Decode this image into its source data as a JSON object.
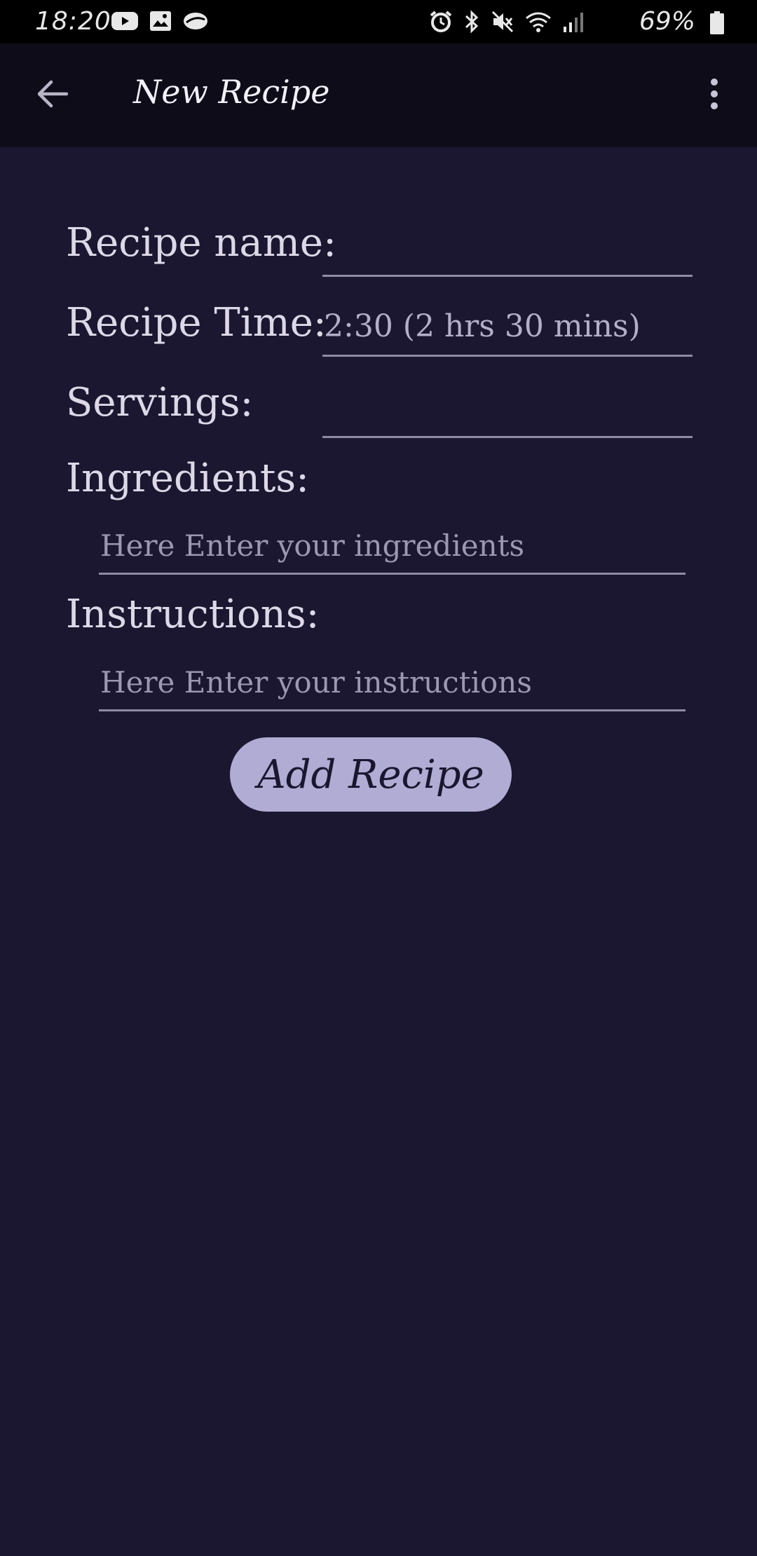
{
  "status_bar": {
    "time": "18:20",
    "battery_percent": "69%",
    "left_icons": [
      "youtube-icon",
      "image-icon",
      "notification-app-icon"
    ],
    "right_icons": [
      "alarm-icon",
      "bluetooth-icon",
      "mute-icon",
      "wifi-icon",
      "signal-icon",
      "battery-icon"
    ]
  },
  "app_bar": {
    "title": "New Recipe",
    "back_icon": "arrow-left-icon",
    "menu_icon": "more-vert-icon"
  },
  "form": {
    "recipe_name": {
      "label": "Recipe name:",
      "value": ""
    },
    "recipe_time": {
      "label": "Recipe Time:",
      "value": "2:30 (2 hrs 30 mins)"
    },
    "servings": {
      "label": "Servings:",
      "value": ""
    },
    "ingredients": {
      "label": "Ingredients:",
      "placeholder": "Here Enter your ingredients"
    },
    "instructions": {
      "label": "Instructions:",
      "placeholder": "Here Enter your instructions"
    },
    "submit_label": "Add Recipe"
  },
  "colors": {
    "background": "#1b1730",
    "app_bar": "#0e0c18",
    "button": "#b0acd4",
    "button_text": "#1a1630"
  }
}
